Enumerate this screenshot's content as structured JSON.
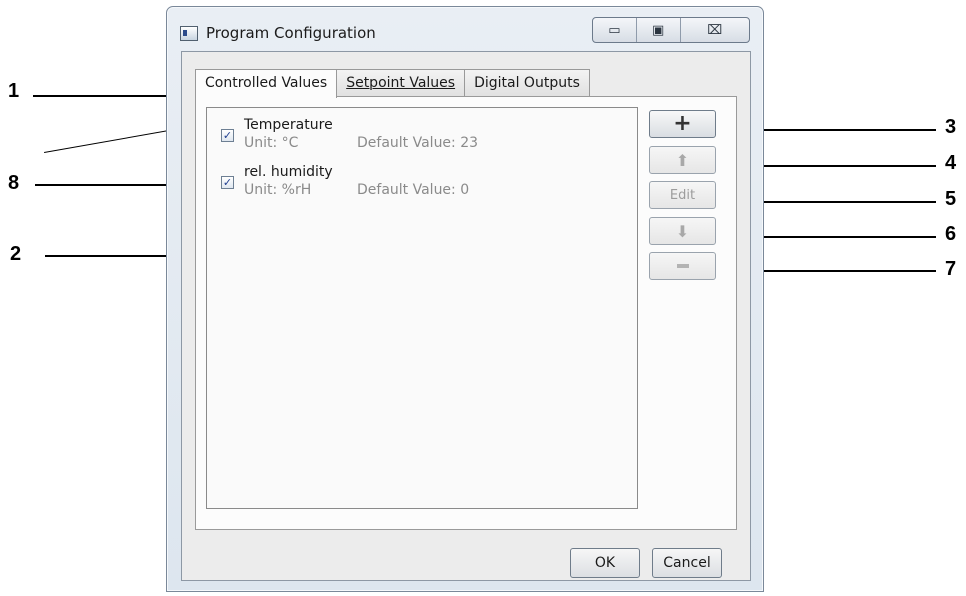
{
  "window": {
    "title": "Program Configuration",
    "controls": {
      "minimize": "▭",
      "maximize": "▣",
      "close": "⌧"
    }
  },
  "tabs": [
    {
      "label": "Controlled Values",
      "active": true
    },
    {
      "label": "Setpoint Values",
      "active": false
    },
    {
      "label": "Digital Outputs",
      "active": false
    }
  ],
  "items": [
    {
      "name": "Temperature",
      "unit": "Unit: °C",
      "default": "Default Value: 23",
      "checked": true,
      "check_glyph": "✓"
    },
    {
      "name": "rel. humidity",
      "unit": "Unit: %rH",
      "default": "Default Value: 0",
      "checked": true,
      "check_glyph": "✓"
    }
  ],
  "side_buttons": {
    "add": "+",
    "up": "⬆",
    "edit": "Edit",
    "down": "⬇"
  },
  "dialog_buttons": {
    "ok": "OK",
    "cancel": "Cancel"
  },
  "callouts": [
    "1",
    "2",
    "3",
    "4",
    "5",
    "6",
    "7",
    "8"
  ]
}
